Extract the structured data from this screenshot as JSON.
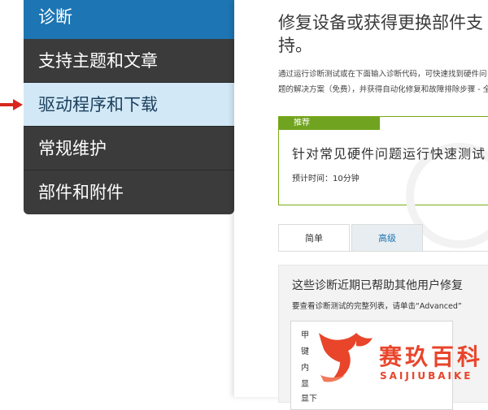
{
  "sidebar": {
    "items": [
      {
        "label": "诊断"
      },
      {
        "label": "支持主题和文章"
      },
      {
        "label": "驱动程序和下载"
      },
      {
        "label": "常规维护"
      },
      {
        "label": "部件和附件"
      }
    ]
  },
  "main": {
    "title": "修复设备或获得更换部件支持。",
    "description": "通过运行诊断测试或在下面输入诊断代码，可快速找到硬件问题的解决方案（免费），并获得自动化修复和故障排除步骤 - 全部",
    "recommended": {
      "badge": "推荐",
      "title": "针对常见硬件问题运行快速测试",
      "time": "预计时间：10分钟"
    },
    "tabs": [
      {
        "label": "简单"
      },
      {
        "label": "高级"
      }
    ],
    "panel": {
      "title": "这些诊断近期已帮助其他用户修复",
      "note": "要查看诊断测试的完整列表，请单击“Advanced”",
      "list_lines": [
        "甲",
        "键",
        "内",
        "显",
        "显下"
      ]
    }
  },
  "watermark": {
    "name": "赛玖百科",
    "sub": "SAIJIUBAIKE"
  },
  "colors": {
    "nav_bg": "#3b3b3b",
    "nav_active": "#1d75b3",
    "nav_hover": "#d2e8f6",
    "recommend_green": "#70a31f",
    "marker_red": "#d9261c",
    "logo_red": "#e8452b"
  }
}
